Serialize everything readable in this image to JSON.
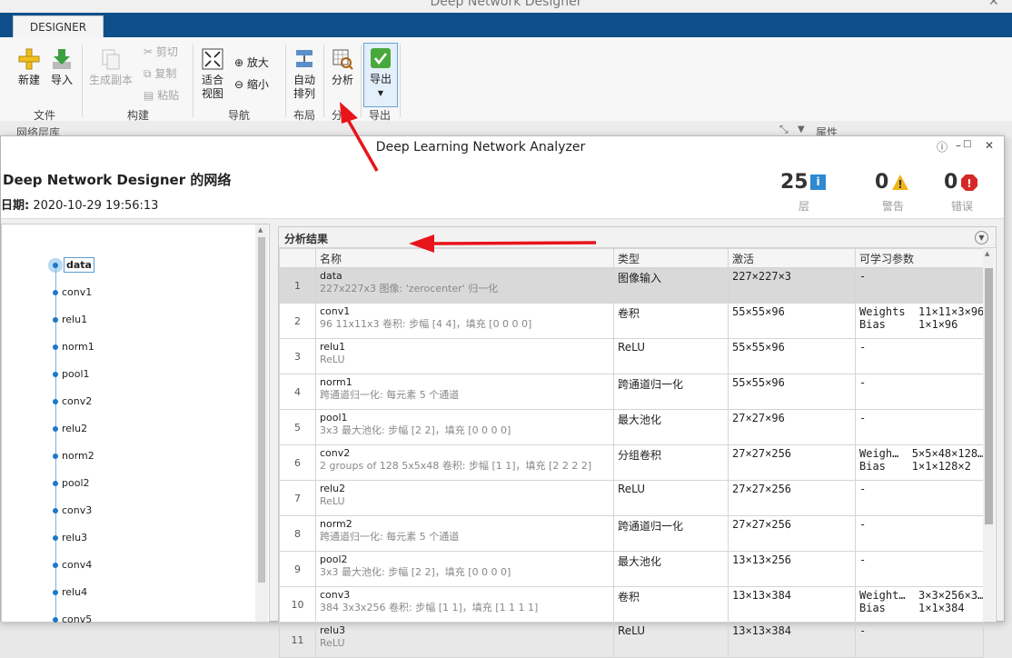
{
  "app": {
    "title": "Deep Network Designer",
    "tab": "DESIGNER",
    "lower_left": "网络层库",
    "lower_right": "属性"
  },
  "ribbon": {
    "file": {
      "new": "新建",
      "import": "导入",
      "group": "文件"
    },
    "build": {
      "duplicate": "生成副本",
      "cut": "剪切",
      "copy": "复制",
      "paste": "粘贴",
      "group": "构建"
    },
    "navigate": {
      "fit": "适合视图",
      "zoom_in": "放大",
      "zoom_out": "缩小",
      "group": "导航"
    },
    "layout": {
      "auto": "自动排列",
      "group": "布局"
    },
    "analyze": {
      "analyze": "分析",
      "group": "分"
    },
    "export": {
      "export": "导出",
      "group": "导出"
    }
  },
  "analyzer": {
    "title": "Deep Learning Network Analyzer",
    "net_name": "Deep Network Designer 的网络",
    "date_label": "日期:",
    "date": "2020-10-29 19:56:13",
    "layers_count": "25",
    "layers_label": "层",
    "warnings_count": "0",
    "warnings_label": "警告",
    "errors_count": "0",
    "errors_label": "错误"
  },
  "graph": {
    "nodes": [
      "data",
      "conv1",
      "relu1",
      "norm1",
      "pool1",
      "conv2",
      "relu2",
      "norm2",
      "pool2",
      "conv3",
      "relu3",
      "conv4",
      "relu4",
      "conv5"
    ]
  },
  "results": {
    "title": "分析结果",
    "columns": {
      "name": "名称",
      "type": "类型",
      "activation": "激活",
      "learnables": "可学习参数"
    },
    "rows": [
      {
        "idx": "1",
        "name": "data",
        "desc": "227x227x3 图像: 'zerocenter' 归一化",
        "type": "图像输入",
        "act": "227×227×3",
        "learn1": "-",
        "learn2": ""
      },
      {
        "idx": "2",
        "name": "conv1",
        "desc": "96 11x11x3 卷积: 步幅 [4 4]，填充 [0 0 0 0]",
        "type": "卷积",
        "act": "55×55×96",
        "learn1": "Weights  11×11×3×96",
        "learn2": "Bias     1×1×96"
      },
      {
        "idx": "3",
        "name": "relu1",
        "desc": "ReLU",
        "type": "ReLU",
        "act": "55×55×96",
        "learn1": "-",
        "learn2": ""
      },
      {
        "idx": "4",
        "name": "norm1",
        "desc": "跨通道归一化: 每元素 5 个通道",
        "type": "跨通道归一化",
        "act": "55×55×96",
        "learn1": "-",
        "learn2": ""
      },
      {
        "idx": "5",
        "name": "pool1",
        "desc": "3x3 最大池化: 步幅 [2 2]，填充 [0 0 0 0]",
        "type": "最大池化",
        "act": "27×27×96",
        "learn1": "-",
        "learn2": ""
      },
      {
        "idx": "6",
        "name": "conv2",
        "desc": "2 groups of 128 5x5x48 卷积: 步幅 [1 1]，填充 [2 2 2 2]",
        "type": "分组卷积",
        "act": "27×27×256",
        "learn1": "Weigh…  5×5×48×128…",
        "learn2": "Bias    1×1×128×2"
      },
      {
        "idx": "7",
        "name": "relu2",
        "desc": "ReLU",
        "type": "ReLU",
        "act": "27×27×256",
        "learn1": "-",
        "learn2": ""
      },
      {
        "idx": "8",
        "name": "norm2",
        "desc": "跨通道归一化: 每元素 5 个通道",
        "type": "跨通道归一化",
        "act": "27×27×256",
        "learn1": "-",
        "learn2": ""
      },
      {
        "idx": "9",
        "name": "pool2",
        "desc": "3x3 最大池化: 步幅 [2 2]，填充 [0 0 0 0]",
        "type": "最大池化",
        "act": "13×13×256",
        "learn1": "-",
        "learn2": ""
      },
      {
        "idx": "10",
        "name": "conv3",
        "desc": "384 3x3x256 卷积: 步幅 [1 1]，填充 [1 1 1 1]",
        "type": "卷积",
        "act": "13×13×384",
        "learn1": "Weight…  3×3×256×3…",
        "learn2": "Bias     1×1×384"
      },
      {
        "idx": "11",
        "name": "relu3",
        "desc": "ReLU",
        "type": "ReLU",
        "act": "13×13×384",
        "learn1": "-",
        "learn2": ""
      }
    ]
  },
  "colors": {
    "ribbon_bar": "#0e4f8a",
    "annotation_arrow": "#e8141b",
    "info": "#2f8ad0",
    "warning": "#f2b418",
    "error": "#d62828"
  }
}
